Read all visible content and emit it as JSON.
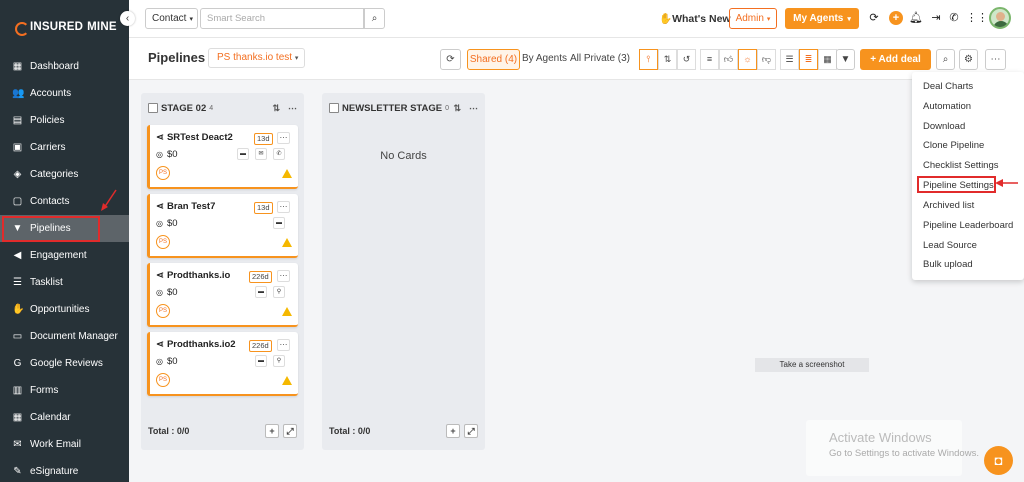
{
  "brand": {
    "name_bold": "INSURED",
    "name_light": "MINE"
  },
  "sidebar": {
    "items": [
      {
        "label": "Dashboard",
        "icon": "grid-icon"
      },
      {
        "label": "Accounts",
        "icon": "users-icon"
      },
      {
        "label": "Policies",
        "icon": "document-icon"
      },
      {
        "label": "Carriers",
        "icon": "briefcase-icon"
      },
      {
        "label": "Categories",
        "icon": "layers-icon"
      },
      {
        "label": "Contacts",
        "icon": "contact-card-icon"
      },
      {
        "label": "Pipelines",
        "icon": "funnel-icon",
        "active": true
      },
      {
        "label": "Engagement",
        "icon": "megaphone-icon"
      },
      {
        "label": "Tasklist",
        "icon": "list-icon"
      },
      {
        "label": "Opportunities",
        "icon": "handshake-icon"
      },
      {
        "label": "Document Manager",
        "icon": "folder-icon"
      },
      {
        "label": "Google Reviews",
        "icon": "google-icon"
      },
      {
        "label": "Forms",
        "icon": "form-icon"
      },
      {
        "label": "Calendar",
        "icon": "calendar-icon"
      },
      {
        "label": "Work Email",
        "icon": "mail-icon"
      },
      {
        "label": "eSignature",
        "icon": "signature-icon"
      }
    ]
  },
  "topbar": {
    "contact_select": "Contact",
    "search_placeholder": "Smart Search",
    "whats_new": "What's New",
    "admin_select": "Admin",
    "my_agents": "My Agents"
  },
  "header": {
    "title": "Pipelines",
    "pipeline_select": "PS thanks.io test",
    "shared": "Shared (4)",
    "by_agents": "By Agents",
    "all_private": "All Private (3)",
    "add_deal": "Add deal"
  },
  "columns": [
    {
      "name": "STAGE 02",
      "count": "4",
      "footer": "Total : 0/0",
      "cards": [
        {
          "name": "SRTest Deact2",
          "amount": "$0",
          "days": "13d",
          "badge": "PS"
        },
        {
          "name": "Bran Test7",
          "amount": "$0",
          "days": "13d",
          "badge": "PS"
        },
        {
          "name": "Prodthanks.io",
          "amount": "$0",
          "days": "226d",
          "badge": "PS"
        },
        {
          "name": "Prodthanks.io2",
          "amount": "$0",
          "days": "226d",
          "badge": "PS"
        }
      ]
    },
    {
      "name": "NEWSLETTER STAGE",
      "count": "0",
      "footer": "Total : 0/0",
      "empty": "No Cards"
    }
  ],
  "dropdown": {
    "items": [
      "Deal Charts",
      "Automation",
      "Download",
      "Clone Pipeline",
      "Checklist Settings",
      "Pipeline Settings",
      "Archived list",
      "Pipeline Leaderboard",
      "Lead Source",
      "Bulk upload"
    ],
    "highlighted": "Pipeline Settings"
  },
  "tooltip": "Take a screenshot",
  "watermark": {
    "title": "Activate Windows",
    "subtitle": "Go to Settings to activate Windows."
  },
  "colors": {
    "accent": "#f7931e",
    "sidebar": "#273238",
    "annotation": "#e12b2b"
  }
}
